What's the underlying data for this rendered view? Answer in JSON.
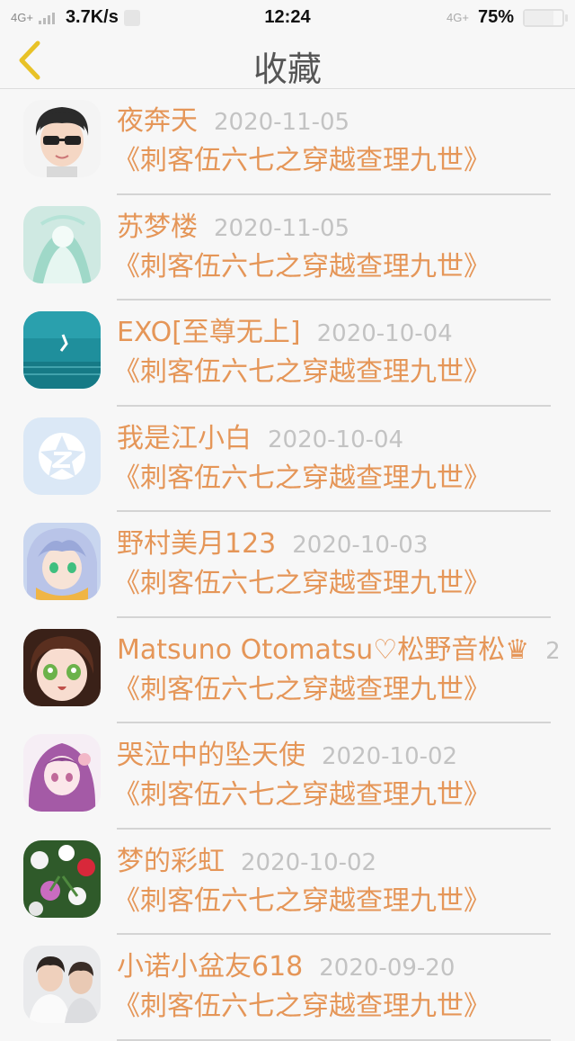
{
  "status_bar": {
    "signal": "4G+",
    "speed": "3.7K/s",
    "time": "12:24",
    "network_right": "4G+",
    "battery": "75%",
    "battery_level": 0.75
  },
  "header": {
    "title": "收藏",
    "back_icon": "chevron-left-icon",
    "accent_color": "#e8c227"
  },
  "colors": {
    "name": "#e59658",
    "title": "#e59658",
    "date": "#c3c3c3"
  },
  "favorites": [
    {
      "user": "夜奔天",
      "date": "2020-11-05",
      "title": "《刺客伍六七之穿越查理九世》",
      "avatar": "avatar-cartoon-boy-sunglasses"
    },
    {
      "user": "苏梦楼",
      "date": "2020-11-05",
      "title": "《刺客伍六七之穿越查理九世》",
      "avatar": "avatar-anime-mint"
    },
    {
      "user": "EXO[至尊无上]",
      "date": "2020-10-04",
      "title": "《刺客伍六七之穿越查理九世》",
      "avatar": "avatar-teal-underwater"
    },
    {
      "user": "我是江小白",
      "date": "2020-10-04",
      "title": "《刺客伍六七之穿越查理九世》",
      "avatar": "avatar-default-qq"
    },
    {
      "user": "野村美月123",
      "date": "2020-10-03",
      "title": "《刺客伍六七之穿越查理九世》",
      "avatar": "avatar-anime-silver-hair"
    },
    {
      "user": "Matsuno Otomatsu♡松野音松♛",
      "date": "2",
      "title": "《刺客伍六七之穿越查理九世》",
      "avatar": "avatar-anime-girl-brown"
    },
    {
      "user": "哭泣中的坠天使",
      "date": "2020-10-02",
      "title": "《刺客伍六七之穿越查理九世》",
      "avatar": "avatar-anime-purple-hair"
    },
    {
      "user": "梦的彩虹",
      "date": "2020-10-02",
      "title": "《刺客伍六七之穿越查理九世》",
      "avatar": "avatar-flowers"
    },
    {
      "user": "小诺小盆友618",
      "date": "2020-09-20",
      "title": "《刺客伍六七之穿越查理九世》",
      "avatar": "avatar-photo-boys"
    }
  ]
}
